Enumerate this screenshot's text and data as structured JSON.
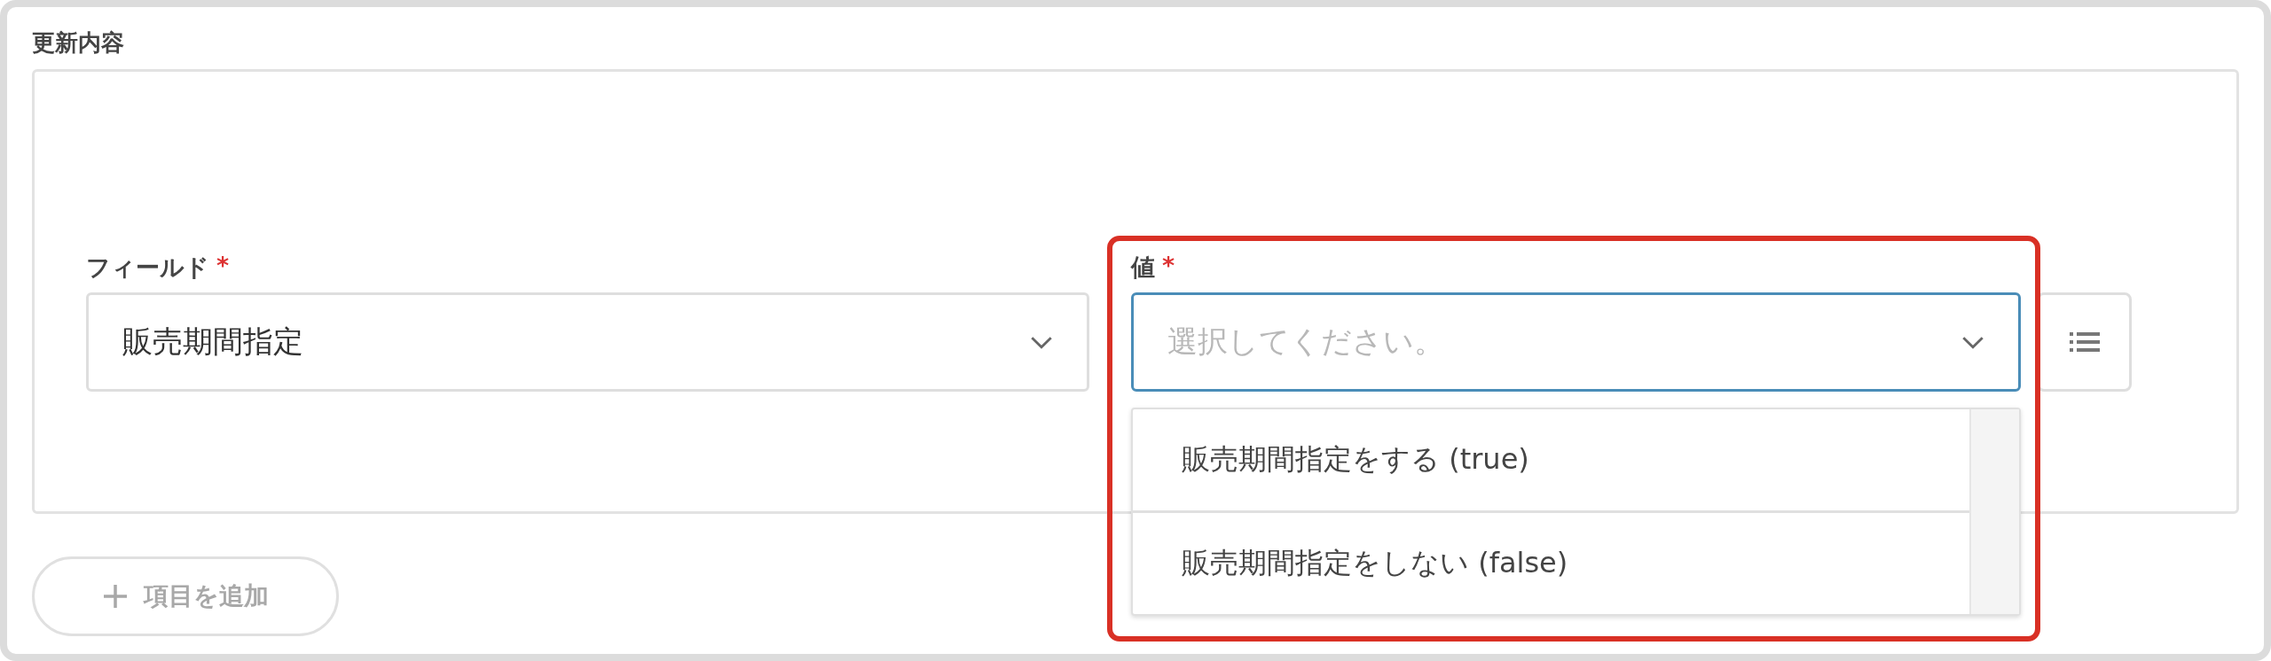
{
  "section_title": "更新内容",
  "field": {
    "label": "フィールド",
    "required_mark": "*",
    "value": "販売期間指定"
  },
  "value": {
    "label": "値",
    "required_mark": "*",
    "placeholder": "選択してください。",
    "focused": true,
    "highlighted": true,
    "options": [
      {
        "label": "販売期間指定をする (true)",
        "selected": false
      },
      {
        "label": "販売期間指定をしない (false)",
        "selected": false
      }
    ]
  },
  "add_button": {
    "label": "項目を追加",
    "disabled": true
  }
}
